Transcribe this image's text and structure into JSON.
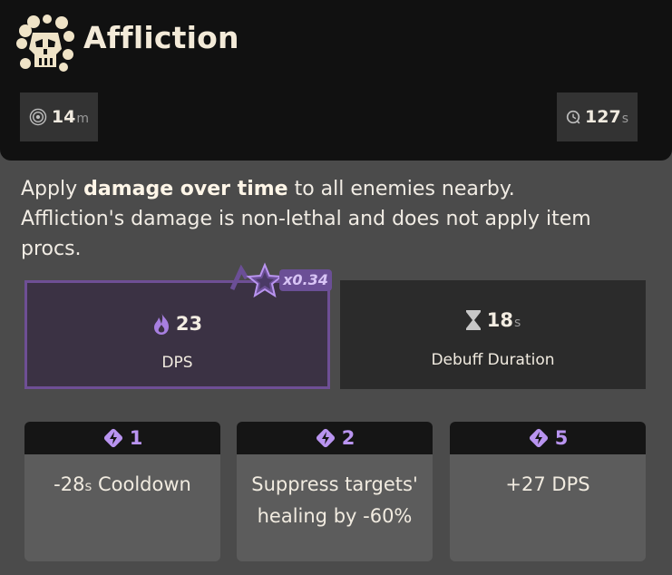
{
  "ability": {
    "title": "Affliction",
    "icon": "affliction-skull-icon"
  },
  "header_stats": {
    "range": {
      "value": "14",
      "unit": "m",
      "icon": "range-target-icon"
    },
    "cooldown": {
      "value": "127",
      "unit": "s",
      "icon": "cooldown-clock-icon"
    }
  },
  "description": {
    "pre": "Apply ",
    "bold": "damage over time",
    "post": " to all enemies nearby.",
    "line2": "Affliction's damage is non-lethal and does not apply item procs."
  },
  "stats": {
    "dps": {
      "value": "23",
      "label": "DPS",
      "icon": "spirit-flame-icon",
      "multiplier": "x0.34",
      "multiplier_icon": "spirit-star-icon"
    },
    "debuff": {
      "value": "18",
      "unit": "s",
      "label": "Debuff Duration",
      "icon": "hourglass-icon"
    }
  },
  "upgrades": [
    {
      "level": "1",
      "icon": "ability-point-icon",
      "value": "-28",
      "unit": "s",
      "text": " Cooldown"
    },
    {
      "level": "2",
      "icon": "ability-point-icon",
      "text": "Suppress targets' healing by -60%"
    },
    {
      "level": "5",
      "icon": "ability-point-icon",
      "text": "+27 DPS"
    }
  ],
  "colors": {
    "header_bg": "#111111",
    "card_bg": "#4b4b4b",
    "accent_purple": "#6e4f95",
    "upgrade_level": "#b994f0"
  }
}
